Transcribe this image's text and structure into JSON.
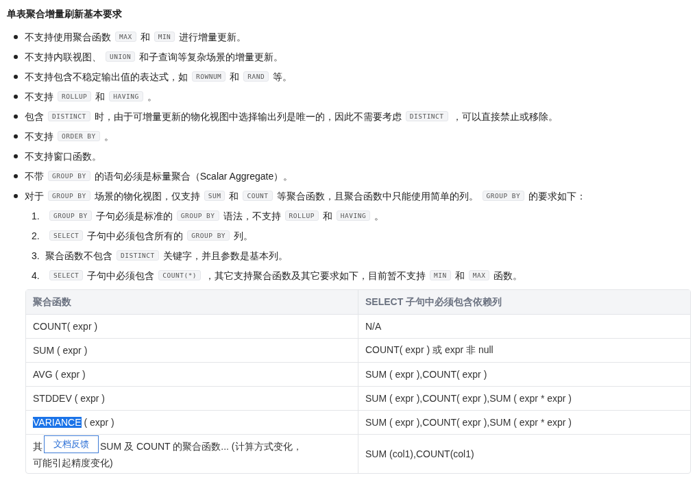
{
  "heading": "单表聚合增量刷新基本要求",
  "items": [
    {
      "parts": [
        {
          "kind": "text",
          "text": "不支持使用聚合函数"
        },
        {
          "kind": "code",
          "text": "MAX"
        },
        {
          "kind": "text",
          "text": "和"
        },
        {
          "kind": "code",
          "text": "MIN"
        },
        {
          "kind": "text",
          "text": "进行增量更新。"
        }
      ]
    },
    {
      "parts": [
        {
          "kind": "text",
          "text": "不支持内联视图、"
        },
        {
          "kind": "code",
          "text": "UNION"
        },
        {
          "kind": "text",
          "text": "和子查询等复杂场景的增量更新。"
        }
      ]
    },
    {
      "parts": [
        {
          "kind": "text",
          "text": "不支持包含不稳定输出值的表达式，如"
        },
        {
          "kind": "code",
          "text": "ROWNUM"
        },
        {
          "kind": "text",
          "text": "和"
        },
        {
          "kind": "code",
          "text": "RAND"
        },
        {
          "kind": "text",
          "text": "等。"
        }
      ]
    },
    {
      "parts": [
        {
          "kind": "text",
          "text": "不支持"
        },
        {
          "kind": "code",
          "text": "ROLLUP"
        },
        {
          "kind": "text",
          "text": "和"
        },
        {
          "kind": "code",
          "text": "HAVING"
        },
        {
          "kind": "text",
          "text": "。"
        }
      ]
    },
    {
      "parts": [
        {
          "kind": "text",
          "text": "包含"
        },
        {
          "kind": "code",
          "text": "DISTINCT"
        },
        {
          "kind": "text",
          "text": "时，由于可增量更新的物化视图中选择输出列是唯一的，因此不需要考虑"
        },
        {
          "kind": "code",
          "text": "DISTINCT"
        },
        {
          "kind": "text",
          "text": "，可以直接禁止或移除。"
        }
      ]
    },
    {
      "parts": [
        {
          "kind": "text",
          "text": "不支持"
        },
        {
          "kind": "code",
          "text": "ORDER BY"
        },
        {
          "kind": "text",
          "text": "。"
        }
      ]
    },
    {
      "parts": [
        {
          "kind": "text",
          "text": "不支持窗口函数。"
        }
      ]
    },
    {
      "parts": [
        {
          "kind": "text",
          "text": "不带"
        },
        {
          "kind": "code",
          "text": "GROUP BY"
        },
        {
          "kind": "text",
          "text": "的语句必须是标量聚合（Scalar Aggregate）。"
        }
      ]
    },
    {
      "parts": [
        {
          "kind": "text",
          "text": "对于"
        },
        {
          "kind": "code",
          "text": "GROUP BY"
        },
        {
          "kind": "text",
          "text": "场景的物化视图，仅支持"
        },
        {
          "kind": "code",
          "text": "SUM"
        },
        {
          "kind": "text",
          "text": "和"
        },
        {
          "kind": "code",
          "text": "COUNT"
        },
        {
          "kind": "text",
          "text": "等聚合函数，且聚合函数中只能使用简单的列。"
        },
        {
          "kind": "code",
          "text": "GROUP BY"
        },
        {
          "kind": "text",
          "text": "的要求如下："
        }
      ],
      "children": [
        {
          "number": "1.",
          "parts": [
            {
              "kind": "code",
              "text": "GROUP BY"
            },
            {
              "kind": "text",
              "text": "子句必须是标准的"
            },
            {
              "kind": "code",
              "text": "GROUP BY"
            },
            {
              "kind": "text",
              "text": "语法，不支持"
            },
            {
              "kind": "code",
              "text": "ROLLUP"
            },
            {
              "kind": "text",
              "text": "和"
            },
            {
              "kind": "code",
              "text": "HAVING"
            },
            {
              "kind": "text",
              "text": "。"
            }
          ]
        },
        {
          "number": "2.",
          "parts": [
            {
              "kind": "code",
              "text": "SELECT"
            },
            {
              "kind": "text",
              "text": "子句中必须包含所有的"
            },
            {
              "kind": "code",
              "text": "GROUP BY"
            },
            {
              "kind": "text",
              "text": "列。"
            }
          ]
        },
        {
          "number": "3.",
          "parts": [
            {
              "kind": "text",
              "text": "聚合函数不包含"
            },
            {
              "kind": "code",
              "text": "DISTINCT"
            },
            {
              "kind": "text",
              "text": "关键字，并且参数是基本列。"
            }
          ]
        },
        {
          "number": "4.",
          "parts": [
            {
              "kind": "code",
              "text": "SELECT"
            },
            {
              "kind": "text",
              "text": "子句中必须包含"
            },
            {
              "kind": "code",
              "text": "COUNT(*)"
            },
            {
              "kind": "text",
              "text": "，其它支持聚合函数及其它要求如下，目前暂不支持"
            },
            {
              "kind": "code",
              "text": "MIN"
            },
            {
              "kind": "text",
              "text": "和"
            },
            {
              "kind": "code",
              "text": "MAX"
            },
            {
              "kind": "text",
              "text": "函数。"
            }
          ]
        }
      ]
    }
  ],
  "table": {
    "columns": [
      "聚合函数",
      "SELECT 子句中必须包含依赖列"
    ],
    "rows": [
      {
        "function": [
          {
            "text": "COUNT( expr )",
            "highlighted": false
          }
        ],
        "dependency": "N/A"
      },
      {
        "function": [
          {
            "text": "SUM ( expr )",
            "highlighted": false
          }
        ],
        "dependency": "COUNT( expr ) 或 expr 非 null"
      },
      {
        "function": [
          {
            "text": "AVG ( expr )",
            "highlighted": false
          }
        ],
        "dependency": "SUM ( expr ),COUNT( expr )"
      },
      {
        "function": [
          {
            "text": "STDDEV ( expr )",
            "highlighted": false
          }
        ],
        "dependency": "SUM ( expr ),COUNT( expr ),SUM ( expr * expr )"
      },
      {
        "function": [
          {
            "text": "VARIANCE",
            "highlighted": true
          },
          {
            "text": " ( expr )",
            "highlighted": false
          }
        ],
        "dependency": "SUM ( expr ),COUNT( expr ),SUM ( expr * expr )"
      },
      {
        "function": [
          {
            "text": "其",
            "highlighted": false
          },
          {
            "text": "SUM 及 COUNT 的聚合函数... (计算方式变化，",
            "highlighted": false
          },
          {
            "text": "可能引起精度变化)",
            "highlighted": false
          }
        ],
        "feedback_button": {
          "label": "文档反馈"
        },
        "dependency": "SUM (col1),COUNT(col1)"
      }
    ]
  }
}
